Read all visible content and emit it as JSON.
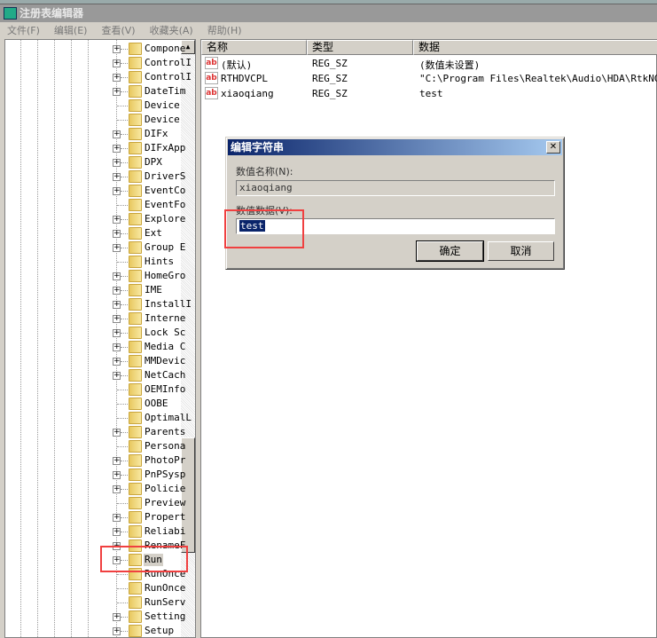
{
  "window": {
    "title": "注册表编辑器"
  },
  "menu": [
    "文件(F)",
    "编辑(E)",
    "查看(V)",
    "收藏夹(A)",
    "帮助(H)"
  ],
  "tree": {
    "items": [
      {
        "label": "Compone",
        "expandable": true
      },
      {
        "label": "ControlI",
        "expandable": true
      },
      {
        "label": "ControlI",
        "expandable": true
      },
      {
        "label": "DateTim",
        "expandable": true
      },
      {
        "label": "Device",
        "expandable": false
      },
      {
        "label": "Device",
        "expandable": false
      },
      {
        "label": "DIFx",
        "expandable": true
      },
      {
        "label": "DIFxApp",
        "expandable": true
      },
      {
        "label": "DPX",
        "expandable": true
      },
      {
        "label": "DriverS",
        "expandable": true
      },
      {
        "label": "EventCo",
        "expandable": true
      },
      {
        "label": "EventFo",
        "expandable": false
      },
      {
        "label": "Explore",
        "expandable": true
      },
      {
        "label": "Ext",
        "expandable": true
      },
      {
        "label": "Group E",
        "expandable": true
      },
      {
        "label": "Hints",
        "expandable": false
      },
      {
        "label": "HomeGro",
        "expandable": true
      },
      {
        "label": "IME",
        "expandable": true
      },
      {
        "label": "InstallI",
        "expandable": true
      },
      {
        "label": "Interne",
        "expandable": true
      },
      {
        "label": "Lock Sc",
        "expandable": true
      },
      {
        "label": "Media C",
        "expandable": true
      },
      {
        "label": "MMDevic",
        "expandable": true
      },
      {
        "label": "NetCach",
        "expandable": true
      },
      {
        "label": "OEMInfo",
        "expandable": false
      },
      {
        "label": "OOBE",
        "expandable": false
      },
      {
        "label": "OptimalL",
        "expandable": false
      },
      {
        "label": "Parents",
        "expandable": true
      },
      {
        "label": "Persona",
        "expandable": false
      },
      {
        "label": "PhotoPr",
        "expandable": true
      },
      {
        "label": "PnPSysp",
        "expandable": true
      },
      {
        "label": "Policie",
        "expandable": true
      },
      {
        "label": "Preview",
        "expandable": false
      },
      {
        "label": "Propert",
        "expandable": true
      },
      {
        "label": "Reliabi",
        "expandable": true
      },
      {
        "label": "RenameF",
        "expandable": true
      },
      {
        "label": "Run",
        "expandable": true,
        "selected": true
      },
      {
        "label": "RunOnce",
        "expandable": false
      },
      {
        "label": "RunOnce",
        "expandable": false
      },
      {
        "label": "RunServ",
        "expandable": false
      },
      {
        "label": "Setting",
        "expandable": true
      },
      {
        "label": "Setup",
        "expandable": true
      }
    ]
  },
  "list": {
    "columns": [
      "名称",
      "类型",
      "数据"
    ],
    "rows": [
      {
        "name": "(默认)",
        "type": "REG_SZ",
        "data": "(数值未设置)"
      },
      {
        "name": "RTHDVCPL",
        "type": "REG_SZ",
        "data": "\"C:\\Program Files\\Realtek\\Audio\\HDA\\RtkNGUI.."
      },
      {
        "name": "xiaoqiang",
        "type": "REG_SZ",
        "data": "test"
      }
    ]
  },
  "dialog": {
    "title": "编辑字符串",
    "name_label": "数值名称(N):",
    "name_value": "xiaoqiang",
    "data_label": "数值数据(V):",
    "data_value": "test",
    "ok": "确定",
    "cancel": "取消"
  },
  "colors": {
    "highlight": "#f04040",
    "selection": "#0a246a"
  }
}
